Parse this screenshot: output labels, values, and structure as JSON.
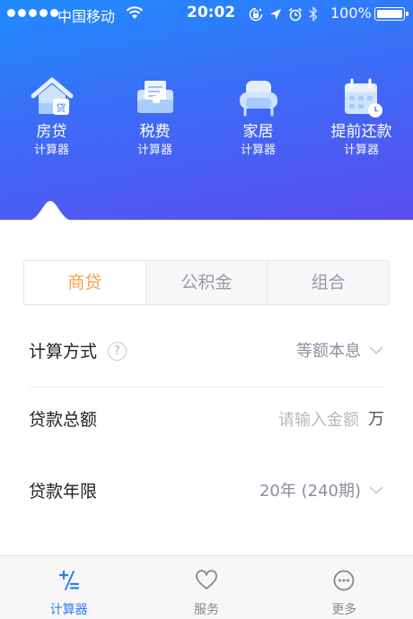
{
  "status_bar": {
    "carrier": "中国移动",
    "time": "20:02",
    "battery": "100%"
  },
  "calc_types": [
    {
      "name": "房贷",
      "sub": "计算器",
      "icon": "house-icon"
    },
    {
      "name": "税费",
      "sub": "计算器",
      "icon": "tax-icon"
    },
    {
      "name": "家居",
      "sub": "计算器",
      "icon": "sofa-icon"
    },
    {
      "name": "提前还款",
      "sub": "计算器",
      "icon": "calendar-icon"
    }
  ],
  "loan_tabs": {
    "commercial": "商贷",
    "provident": "公积金",
    "combined": "组合",
    "active": "商贷"
  },
  "form": {
    "method_label": "计算方式",
    "help_symbol": "?",
    "method_value": "等额本息",
    "amount_label": "贷款总额",
    "amount_placeholder": "请输入金额",
    "amount_unit": "万",
    "term_label": "贷款年限",
    "term_value": "20年 (240期)"
  },
  "tab_bar": {
    "calculator": "计算器",
    "service": "服务",
    "more": "更多",
    "active": "计算器"
  },
  "colors": {
    "header_start": "#1f8bff",
    "header_end": "#5a4df0",
    "active_segment_text": "#f5a04a",
    "active_tab": "#2c7df6"
  }
}
